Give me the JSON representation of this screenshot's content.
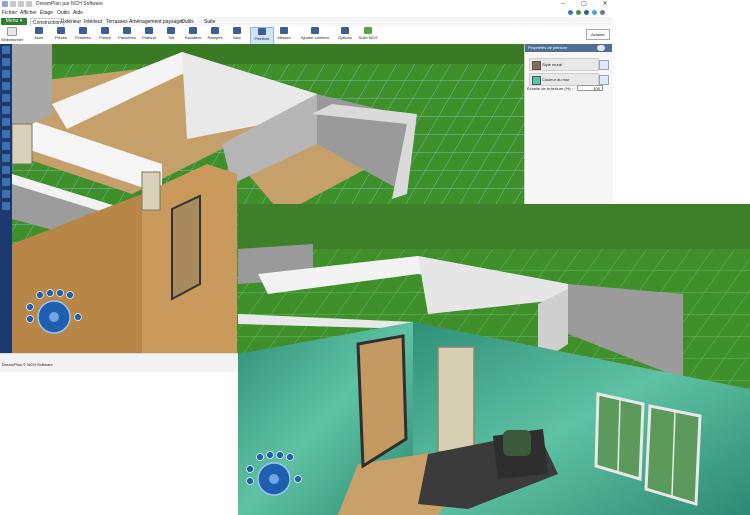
{
  "window": {
    "title": "DreamPlan par NCH Software",
    "controls": [
      "–",
      "▢",
      "✕"
    ]
  },
  "menu": [
    "Fichier",
    "Afficher",
    "Étage",
    "Outils",
    "Aide"
  ],
  "menu_button": "Menu ▾",
  "tabs": [
    "Construction",
    "Extérieur",
    "Intérieur",
    "Terrasses",
    "Aménagement paysager",
    "Outils",
    "Suite"
  ],
  "ribbon": [
    {
      "label": "Sélectionner",
      "icon": "hand-icon"
    },
    {
      "label": "Murs",
      "icon": "wall-icon"
    },
    {
      "label": "Pièces",
      "icon": "rooms-icon"
    },
    {
      "label": "Fenêtres",
      "icon": "window-icon"
    },
    {
      "label": "Portes",
      "icon": "door-icon"
    },
    {
      "label": "Planchers",
      "icon": "floor-icon"
    },
    {
      "label": "Plafond",
      "icon": "ceiling-icon"
    },
    {
      "label": "Toit",
      "icon": "roof-icon"
    },
    {
      "label": "Escaliers",
      "icon": "stairs-icon"
    },
    {
      "label": "Rampes",
      "icon": "railing-icon"
    },
    {
      "label": "Bloc",
      "icon": "block-icon"
    },
    {
      "label": "Peinture",
      "icon": "paint-icon",
      "selected": true
    },
    {
      "label": "Mesure",
      "icon": "measure-icon"
    },
    {
      "label": "Ajouter contenu",
      "icon": "add-content-icon"
    },
    {
      "label": "Options",
      "icon": "options-icon"
    },
    {
      "label": "Suite NCH",
      "icon": "suite-icon"
    }
  ],
  "buy_button": "Acheter",
  "panel": {
    "title": "Propriétés de peinture",
    "rows": [
      {
        "label": "Style mural",
        "swatch": "#8a6b58"
      },
      {
        "label": "Couleur du mur",
        "swatch": "#4fc7a8"
      }
    ],
    "scale_label": "Échelle de la texture (%) :",
    "scale_value": "100"
  },
  "status": "DreamPlan © NCH Software",
  "colors": {
    "grass": "#3f8f2a",
    "grid": "#7fd0e0",
    "wall_white": "#f4f4f4",
    "wall_grey": "#9b9b9b",
    "wood": "#c9a06a",
    "teal_wall": "#3c9f86",
    "sofa": "#3a3a3a"
  }
}
